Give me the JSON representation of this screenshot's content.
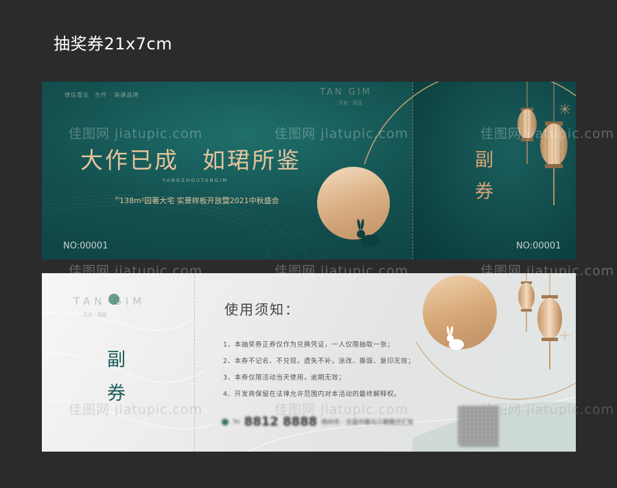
{
  "page": {
    "title": "抽奖券21x7cm",
    "watermark": "佳图网 jiatupic.com"
  },
  "front": {
    "logos": [
      "德信置业",
      "合作 · 联建品牌"
    ],
    "brand": "TAN  GIM",
    "brand_sub": "天安 · 君庭",
    "headline_left": "大作已成",
    "headline_right": "如珺所鉴",
    "pinyin": "YANGZHOUTANGIM",
    "event_prefix": "约",
    "event": "138m²园著大宅  实景样板开放暨2021中秋盛会",
    "serial_left": "NO:00001",
    "serial_right": "NO:00001",
    "stub_label_1": "副",
    "stub_label_2": "券"
  },
  "back": {
    "brand": "TAN  GIM",
    "brand_sub": "天安 · 君庭",
    "stub_label_1": "副",
    "stub_label_2": "券",
    "notice_title": "使用须知：",
    "rules": [
      "1、本抽奖券正券仅作为兑换凭证，一人仅限抽取一张；",
      "2、本券不记名、不兑现，遗失不补，涂改、撕毁、复印无效；",
      "3、本券仅限活动当天使用，逾期无效；",
      "4、开发商保留在法律允许范围内对本活动的最终解释权。"
    ],
    "phone_label": "Tel",
    "phone": "8812 8888",
    "address": "扬州市 · 文昌中路与江都路交汇处"
  },
  "colors": {
    "teal": "#13504f",
    "gold": "#e3c49c",
    "back_teal": "#1a5c5a"
  }
}
